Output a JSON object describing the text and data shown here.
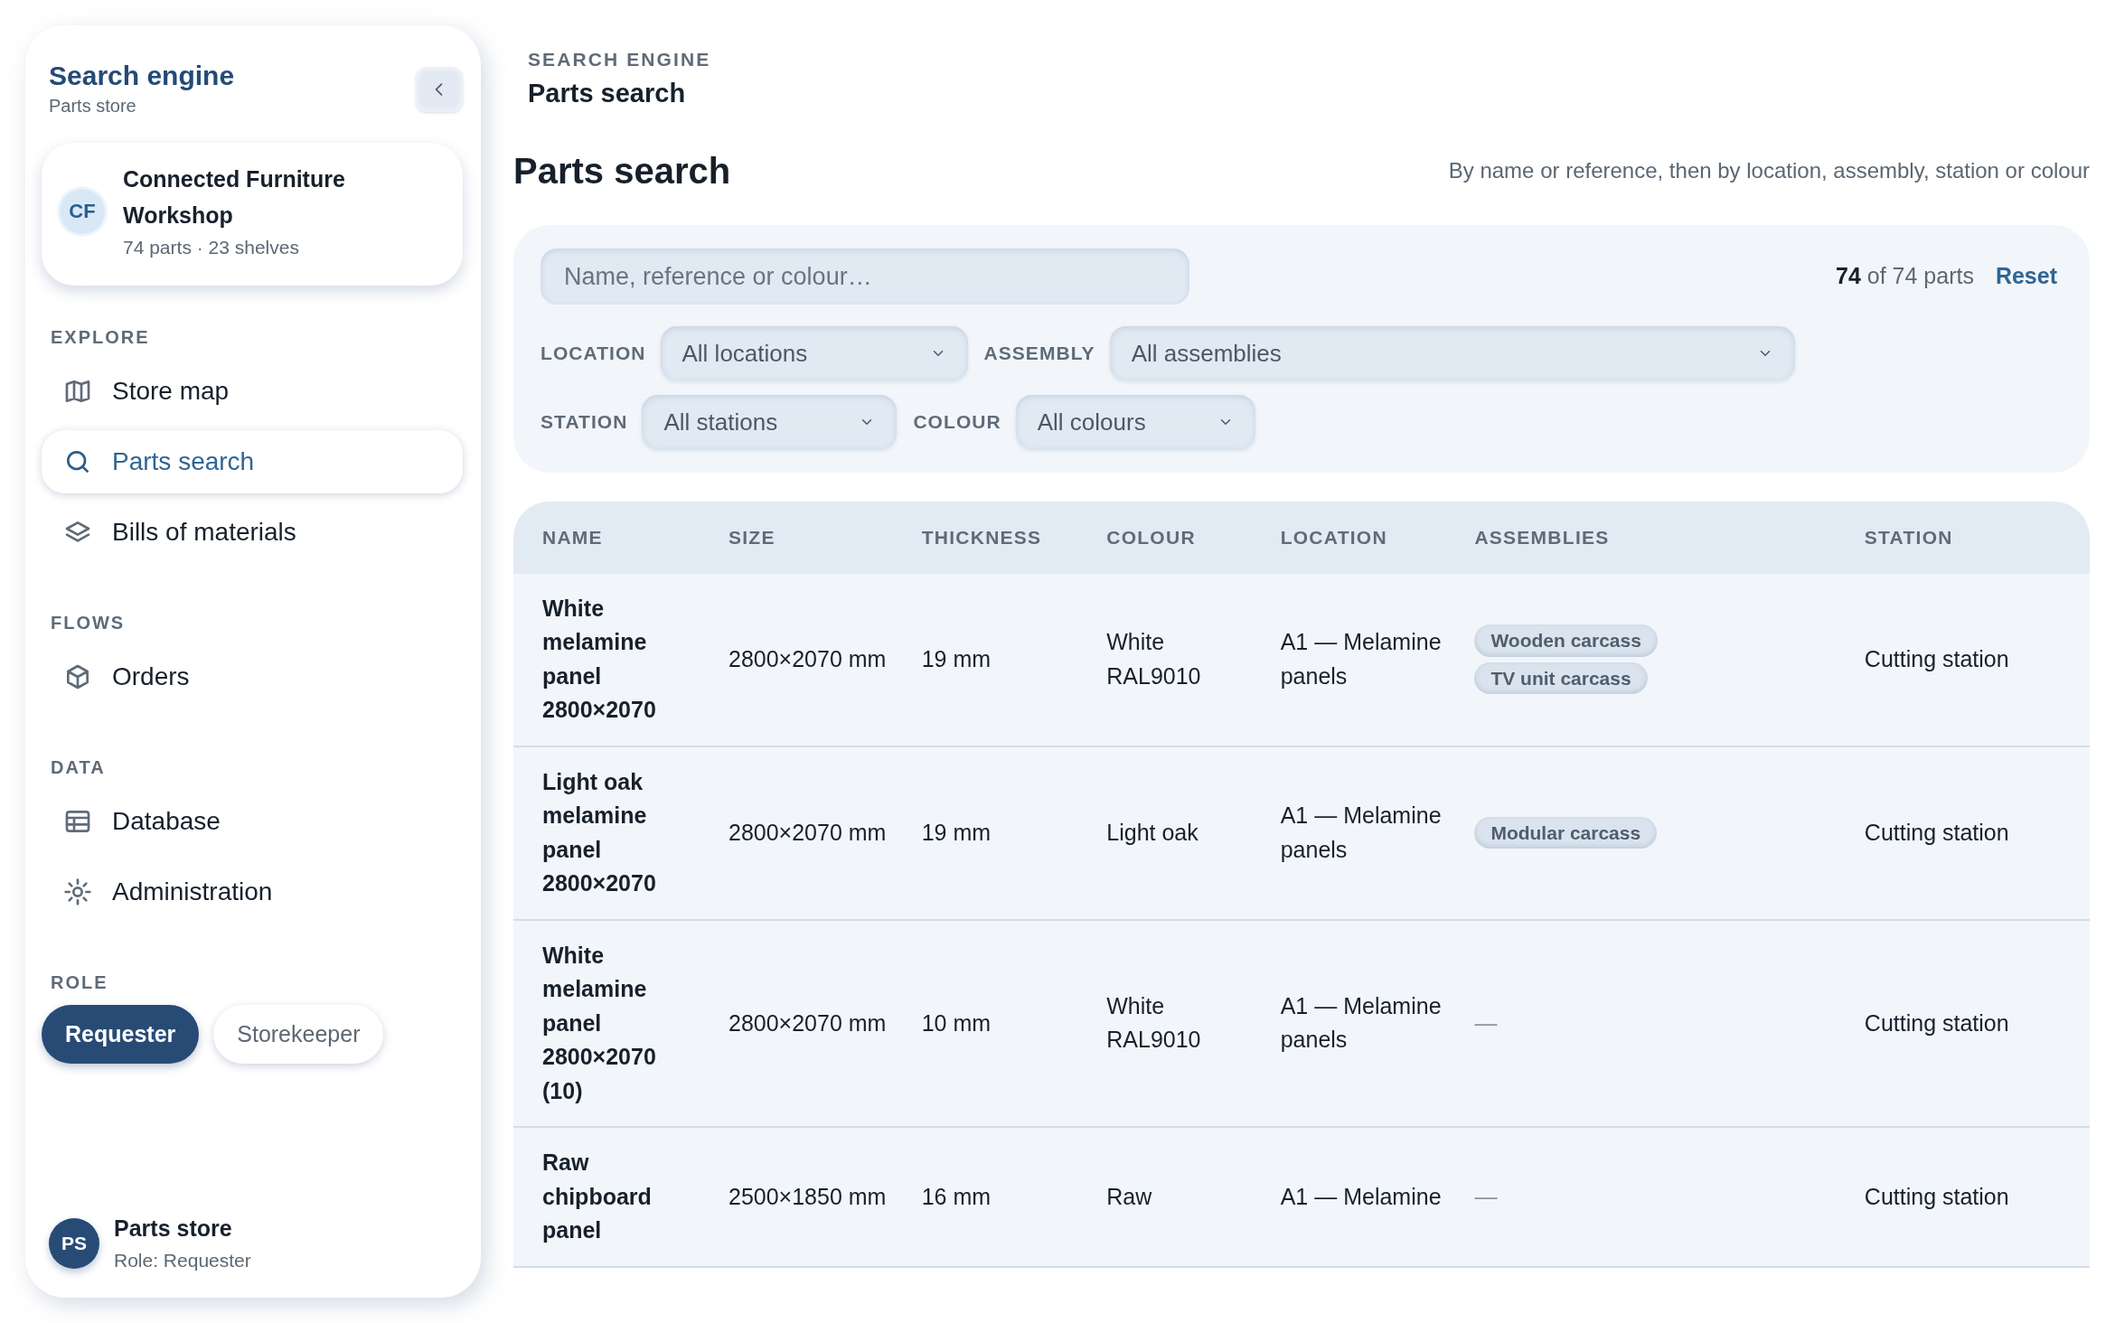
{
  "sidebar": {
    "title": "Search engine",
    "subtitle": "Parts store",
    "workspace": {
      "initials": "CF",
      "name": "Connected Furniture Workshop",
      "meta": "74 parts · 23 shelves"
    },
    "sections": [
      {
        "heading": "EXPLORE",
        "items": [
          {
            "label": "Store map",
            "selected": false
          },
          {
            "label": "Parts search",
            "selected": true
          },
          {
            "label": "Bills of materials",
            "selected": false
          }
        ]
      },
      {
        "heading": "FLOWS",
        "items": [
          {
            "label": "Orders",
            "selected": false
          }
        ]
      },
      {
        "heading": "DATA",
        "items": [
          {
            "label": "Database",
            "selected": false
          },
          {
            "label": "Administration",
            "selected": false
          }
        ]
      }
    ],
    "role": {
      "heading": "ROLE",
      "options": [
        {
          "label": "Requester",
          "selected": true
        },
        {
          "label": "Storekeeper",
          "selected": false
        }
      ]
    },
    "user": {
      "initials": "PS",
      "name": "Parts store",
      "role": "Role: Requester"
    }
  },
  "breadcrumb": {
    "section": "SEARCH ENGINE",
    "page": "Parts search"
  },
  "header": {
    "title": "Parts search",
    "hint": "By name or reference, then by location, assembly, station or colour"
  },
  "filters": {
    "search": {
      "placeholder": "Name, reference or colour…"
    },
    "count": "**74** of 74 parts",
    "reset": "Reset",
    "selects": [
      {
        "label": "LOCATION",
        "value": "All locations"
      },
      {
        "label": "ASSEMBLY",
        "value": "All assemblies"
      },
      {
        "label": "STATION",
        "value": "All stations"
      },
      {
        "label": "COLOUR",
        "value": "All colours"
      }
    ]
  },
  "table": {
    "columns": [
      "NAME",
      "SIZE",
      "THICKNESS",
      "COLOUR",
      "LOCATION",
      "ASSEMBLIES",
      "STATION"
    ],
    "rows": [
      {
        "cells": [
          "White melamine panel 2800×2070",
          "2800×2070 mm",
          "19 mm",
          "White RAL9010",
          "A1 — Melamine panels",
          [
            "Wooden carcass",
            "TV unit carcass"
          ],
          "Cutting station"
        ]
      },
      {
        "cells": [
          "Light oak melamine panel 2800×2070",
          "2800×2070 mm",
          "19 mm",
          "Light oak",
          "A1 — Melamine panels",
          [
            "Modular carcass"
          ],
          "Cutting station"
        ]
      },
      {
        "cells": [
          "White melamine panel 2800×2070 (10)",
          "2800×2070 mm",
          "10 mm",
          "White RAL9010",
          "A1 — Melamine panels",
          "—",
          "Cutting station"
        ]
      },
      {
        "cells": [
          "Raw chipboard panel",
          "2500×1850 mm",
          "16 mm",
          "Raw",
          "A1 — Melamine",
          "—",
          "Cutting station"
        ]
      }
    ]
  }
}
